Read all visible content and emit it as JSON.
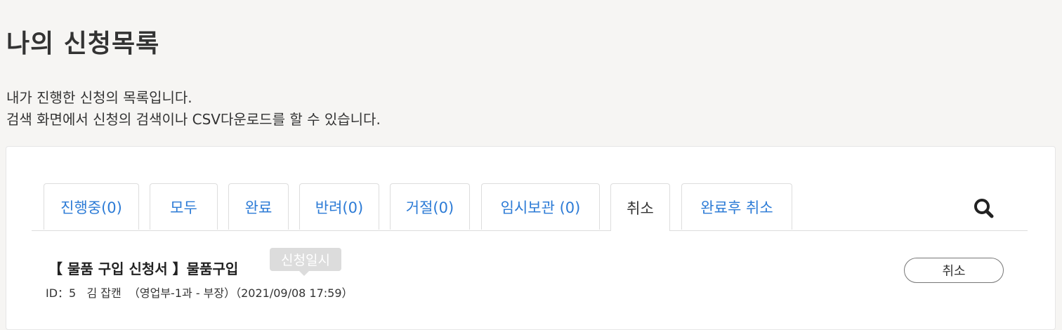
{
  "page": {
    "title": "나의 신청목록",
    "description_lines": [
      "내가 진행한 신청의 목록입니다.",
      "검색 화면에서 신청의 검색이나 CSV다운로드를 할 수 있습니다."
    ]
  },
  "tabs": [
    {
      "label": "진행중(0)",
      "active": false
    },
    {
      "label": "모두",
      "active": false
    },
    {
      "label": "완료",
      "active": false
    },
    {
      "label": "반려(0)",
      "active": false
    },
    {
      "label": "거절(0)",
      "active": false
    },
    {
      "label": "임시보관 (0)",
      "active": false
    },
    {
      "label": "취소",
      "active": true
    },
    {
      "label": "완료후 취소",
      "active": false
    }
  ],
  "search": {
    "icon": "search-icon"
  },
  "item": {
    "title": "【 물품 구입 신청서 】물품구입",
    "tooltip": "신청일시",
    "meta": "ID：5   김 잡캔  （영업부-1과 - 부장）（2021/09/08 17:59）",
    "action_label": "취소"
  },
  "colors": {
    "background": "#f6f5f3",
    "tab_link": "#2c7bd6",
    "active_tab_text": "#333333",
    "tooltip_bg": "#dcdcdc"
  }
}
